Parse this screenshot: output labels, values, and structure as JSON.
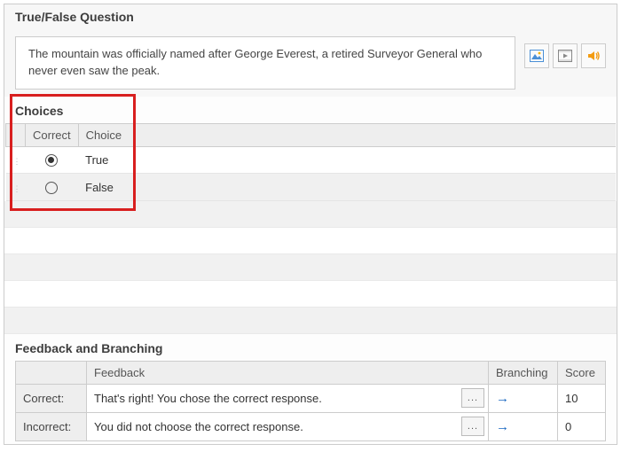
{
  "section_question_title": "True/False Question",
  "question_text": "The mountain was officially named after George Everest, a retired Surveyor General who never even saw the peak.",
  "choices_title": "Choices",
  "choices_header_correct": "Correct",
  "choices_header_choice": "Choice",
  "choices": [
    {
      "label": "True",
      "correct": true
    },
    {
      "label": "False",
      "correct": false
    }
  ],
  "feedback_title": "Feedback and Branching",
  "fb_col_feedback": "Feedback",
  "fb_col_branching": "Branching",
  "fb_col_score": "Score",
  "fb_rows": {
    "correct": {
      "label": "Correct:",
      "feedback": "That's right! You chose the correct response.",
      "score": "10"
    },
    "incorrect": {
      "label": "Incorrect:",
      "feedback": "You did not choose the correct response.",
      "score": "0"
    }
  },
  "ellipsis": "...",
  "arrow": "→"
}
